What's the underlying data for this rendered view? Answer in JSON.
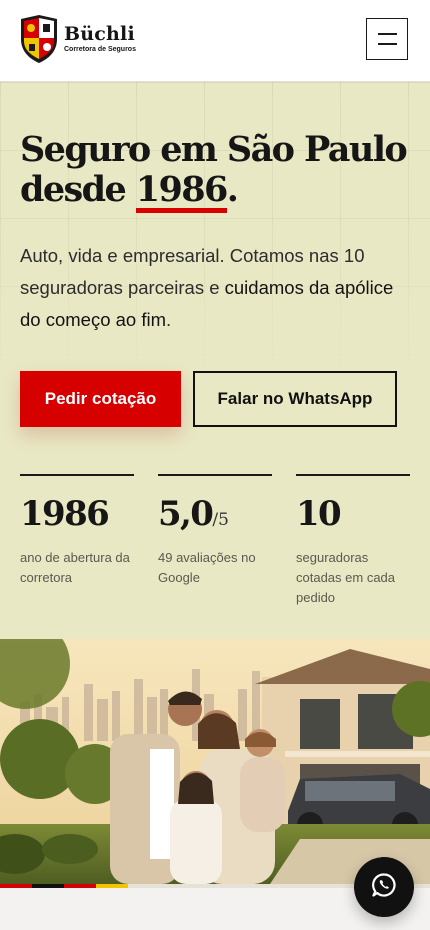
{
  "header": {
    "brand_name": "Büchli",
    "brand_tagline": "Corretora de Seguros",
    "logo_icon": "coat-of-arms-icon",
    "menu_icon": "hamburger-menu-icon"
  },
  "hero": {
    "title_main": "Seguro em São Paulo desde ",
    "title_year": "1986",
    "title_end": ".",
    "description_part1": "Auto, vida e empresarial. Cotamos nas 10 seguradoras parceiras e ",
    "description_strong": "cuidamos da apólice do começo ao fim",
    "description_end": ".",
    "primary_cta": "Pedir cotação",
    "secondary_cta": "Falar no WhatsApp"
  },
  "stats": [
    {
      "value": "1986",
      "suffix": "",
      "label": "ano de abertura da corretora"
    },
    {
      "value": "5,0",
      "suffix": "/5",
      "label": "49 avaliações no Google"
    },
    {
      "value": "10",
      "suffix": "",
      "label": "seguradoras cotadas em cada pedido"
    }
  ],
  "photo": {
    "subject": "family-in-front-of-house-photo"
  },
  "colors": {
    "brand_red": "#d60000",
    "hero_background": "#e9e8c4",
    "text_dark": "#161616",
    "flag_black": "#111111",
    "flag_red": "#d60000",
    "flag_yellow": "#f1c500"
  },
  "whatsapp_fab": {
    "icon": "whatsapp-icon"
  }
}
